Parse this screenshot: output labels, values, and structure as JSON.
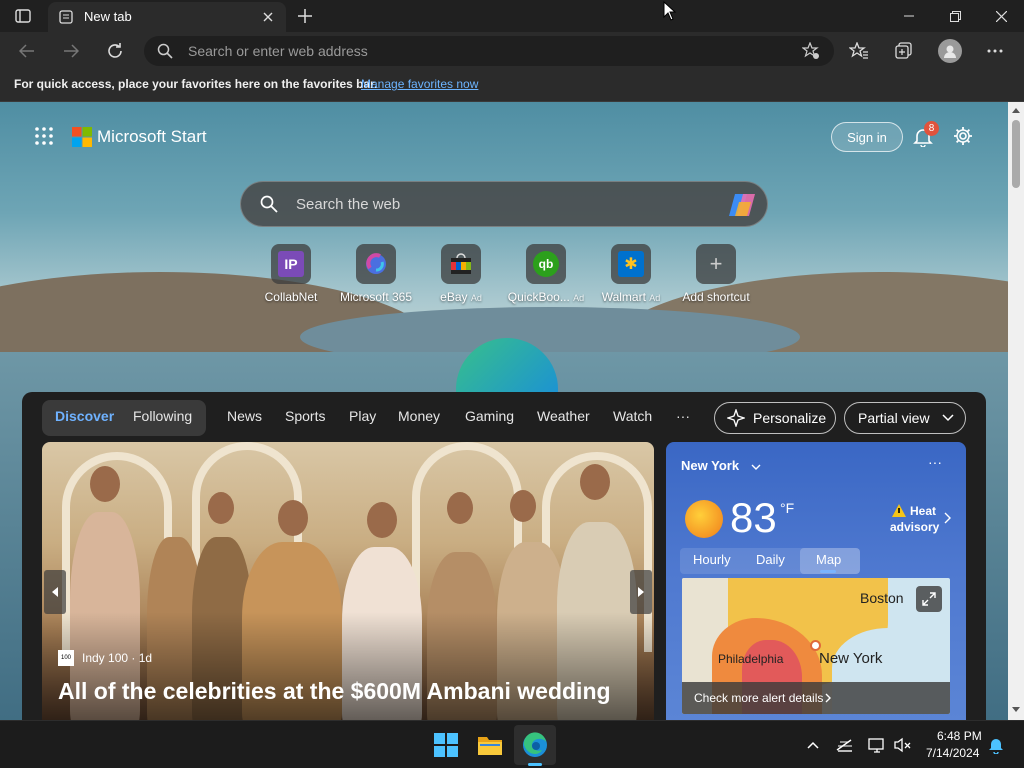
{
  "browser": {
    "tab_title": "New tab",
    "address_placeholder": "Search or enter web address",
    "favorites_message": "For quick access, place your favorites here on the favorites bar.",
    "favorites_link": "Manage favorites now"
  },
  "start": {
    "brand": "Microsoft Start",
    "sign_in": "Sign in",
    "notification_count": "8",
    "search_placeholder": "Search the web",
    "shortcuts": [
      {
        "label": "CollabNet",
        "icon_text": "IP",
        "color": "#7b4bb7"
      },
      {
        "label": "Microsoft 365",
        "icon_text": "",
        "color": "#4a4a7a"
      },
      {
        "label": "eBay",
        "ad": "Ad",
        "icon_text": "",
        "color": "#333"
      },
      {
        "label": "QuickBoo...",
        "ad": "Ad",
        "icon_text": "qb",
        "color": "#2ca01c"
      },
      {
        "label": "Walmart",
        "ad": "Ad",
        "icon_text": "✱",
        "color": "#0071ce"
      },
      {
        "label": "Add shortcut",
        "icon_text": "+",
        "color": "#555"
      }
    ]
  },
  "feed": {
    "tabs": [
      "Discover",
      "Following"
    ],
    "nav": [
      "News",
      "Sports",
      "Play",
      "Money",
      "Gaming",
      "Weather",
      "Watch"
    ],
    "more": "···",
    "personalize": "Personalize",
    "view": "Partial view",
    "hero": {
      "source": "Indy 100 · 1d",
      "headline": "All of the celebrities at the $600M Ambani wedding"
    },
    "weather": {
      "location": "New York",
      "temp": "83",
      "unit": "°F",
      "alert_line1": "Heat",
      "alert_line2": "advisory",
      "tabs": [
        "Hourly",
        "Daily",
        "Map"
      ],
      "map_labels": [
        "Boston",
        "Philadelphia",
        "New York"
      ],
      "alert_details": "Check more alert details"
    }
  },
  "taskbar": {
    "time": "6:48 PM",
    "date": "7/14/2024"
  }
}
